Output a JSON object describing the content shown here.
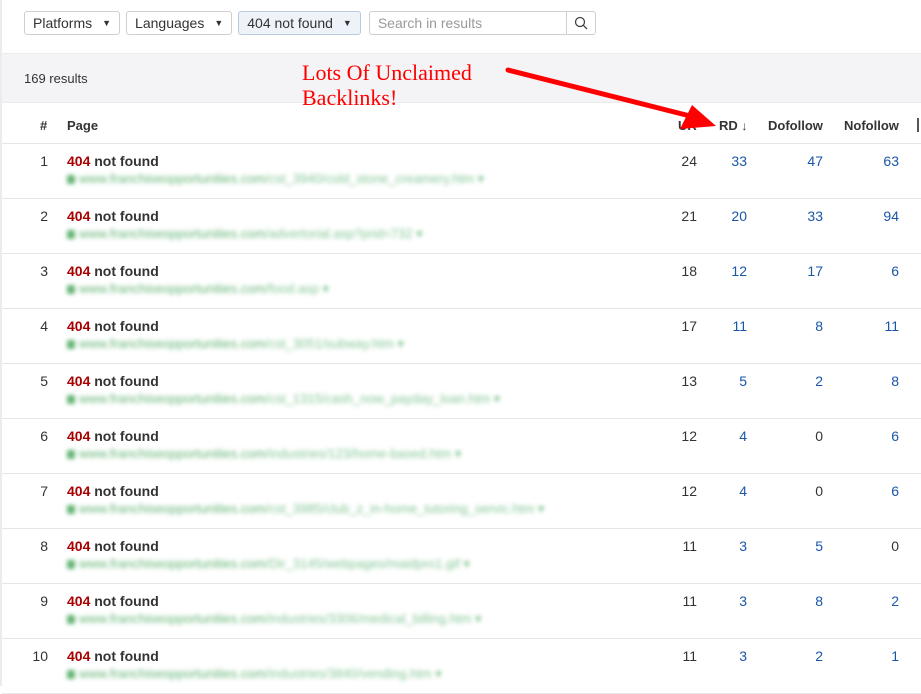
{
  "toolbar": {
    "filters": [
      {
        "label": "Platforms",
        "active": false
      },
      {
        "label": "Languages",
        "active": false
      },
      {
        "label": "404 not found",
        "active": true
      }
    ],
    "search": {
      "placeholder": "Search in results",
      "value": "",
      "icon": "search-icon"
    }
  },
  "results": {
    "count_label": "169 results"
  },
  "annotation": {
    "text": "Lots Of Unclaimed\nBacklinks!",
    "color": "#ff0000"
  },
  "table": {
    "columns": {
      "index": "#",
      "page": "Page",
      "ur": "UR",
      "rd": "RD",
      "rd_sort_icon": "sort-descending-icon",
      "dofollow": "Dofollow",
      "nofollow": "Nofollow"
    },
    "rows": [
      {
        "n": "1",
        "code": "404",
        "status": "not found",
        "url_domain": "www.franchiseopportunities.com",
        "url_path": "/cst_3940/cold_stone_creamery.htm",
        "ur": "24",
        "rd": "33",
        "dofollow": "47",
        "nofollow": "63"
      },
      {
        "n": "2",
        "code": "404",
        "status": "not found",
        "url_domain": "www.franchiseopportunities.com",
        "url_path": "/advertorial.asp?prid=732",
        "ur": "21",
        "rd": "20",
        "dofollow": "33",
        "nofollow": "94"
      },
      {
        "n": "3",
        "code": "404",
        "status": "not found",
        "url_domain": "www.franchiseopportunities.com",
        "url_path": "/food.asp",
        "ur": "18",
        "rd": "12",
        "dofollow": "17",
        "nofollow": "6"
      },
      {
        "n": "4",
        "code": "404",
        "status": "not found",
        "url_domain": "www.franchiseopportunities.com",
        "url_path": "/cst_3051/subway.htm",
        "ur": "17",
        "rd": "11",
        "dofollow": "8",
        "nofollow": "11"
      },
      {
        "n": "5",
        "code": "404",
        "status": "not found",
        "url_domain": "www.franchiseopportunities.com",
        "url_path": "/cst_1315/cash_now_payday_loan.htm",
        "ur": "13",
        "rd": "5",
        "dofollow": "2",
        "nofollow": "8"
      },
      {
        "n": "6",
        "code": "404",
        "status": "not found",
        "url_domain": "www.franchiseopportunities.com",
        "url_path": "/industries/123/home-based.htm",
        "ur": "12",
        "rd": "4",
        "dofollow": "0",
        "nofollow": "6"
      },
      {
        "n": "7",
        "code": "404",
        "status": "not found",
        "url_domain": "www.franchiseopportunities.com",
        "url_path": "/cst_3985/club_z_in-home_tutoring_servic.htm",
        "ur": "12",
        "rd": "4",
        "dofollow": "0",
        "nofollow": "6"
      },
      {
        "n": "8",
        "code": "404",
        "status": "not found",
        "url_domain": "www.franchiseopportunities.com",
        "url_path": "/Dir_3145/webpages/maidpro1.gif",
        "ur": "11",
        "rd": "3",
        "dofollow": "5",
        "nofollow": "0"
      },
      {
        "n": "9",
        "code": "404",
        "status": "not found",
        "url_domain": "www.franchiseopportunities.com",
        "url_path": "/industries/3306/medical_billing.htm",
        "ur": "11",
        "rd": "3",
        "dofollow": "8",
        "nofollow": "2"
      },
      {
        "n": "10",
        "code": "404",
        "status": "not found",
        "url_domain": "www.franchiseopportunities.com",
        "url_path": "/industries/3840/vending.htm",
        "ur": "11",
        "rd": "3",
        "dofollow": "2",
        "nofollow": "1"
      }
    ]
  },
  "colors": {
    "status_code": "#a80000",
    "link_number": "#1a56a8",
    "url": "#2e9a45",
    "annotation": "#ff0000"
  }
}
